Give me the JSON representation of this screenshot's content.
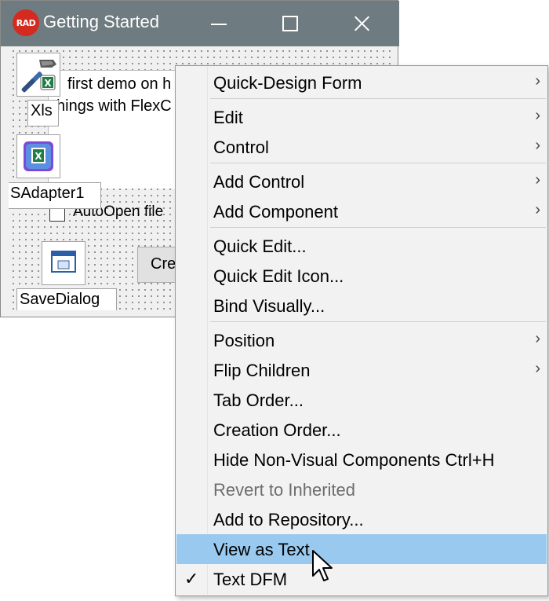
{
  "window": {
    "logo_text": "RAD",
    "title": "Getting Started"
  },
  "form": {
    "memo_line1": "first demo on h",
    "memo_line2": "hings with FlexC",
    "checkbox_label": "AutoOpen file",
    "create_button": "Cre",
    "components": {
      "xls_label": "Xls",
      "adapter_label": "SAdapter1",
      "savedialog_label": "SaveDialog"
    }
  },
  "menu": {
    "items": [
      {
        "label": "Quick-Design Form",
        "submenu": true
      },
      {
        "label": "Edit",
        "submenu": true
      },
      {
        "label": "Control",
        "submenu": true
      },
      {
        "label": "Add Control",
        "submenu": true
      },
      {
        "label": "Add Component",
        "submenu": true
      },
      {
        "label": "Quick Edit...",
        "submenu": false
      },
      {
        "label": "Quick Edit Icon...",
        "submenu": false
      },
      {
        "label": "Bind Visually...",
        "submenu": false
      },
      {
        "label": "Position",
        "submenu": true
      },
      {
        "label": "Flip Children",
        "submenu": true
      },
      {
        "label": "Tab Order...",
        "submenu": false
      },
      {
        "label": "Creation Order...",
        "submenu": false
      },
      {
        "label": "Hide Non-Visual Components Ctrl+H",
        "submenu": false
      },
      {
        "label": "Revert to Inherited",
        "submenu": false,
        "disabled": true
      },
      {
        "label": "Add to Repository...",
        "submenu": false
      },
      {
        "label": "View as Text",
        "submenu": false,
        "selected": true
      },
      {
        "label": "Text DFM",
        "submenu": false,
        "checked": true
      }
    ],
    "arrow_glyph": "›",
    "check_glyph": "✓"
  },
  "colors": {
    "titlebar": "#6e7b80",
    "menu_highlight": "#99c9ef",
    "logo": "#d42a1f"
  }
}
